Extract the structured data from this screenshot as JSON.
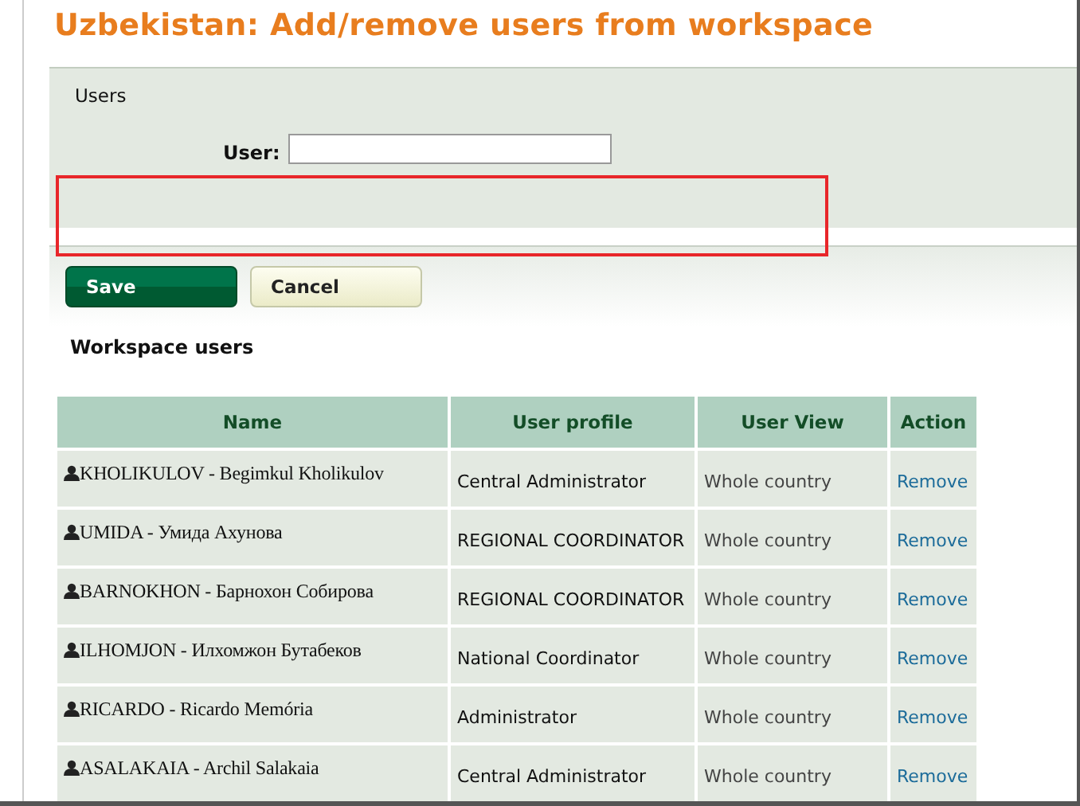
{
  "title": "Uzbekistan: Add/remove users from workspace",
  "users_panel": {
    "heading": "Users",
    "field_label": "User:",
    "highlighted": true
  },
  "buttons": [
    {
      "label": "Save",
      "kind": "primary"
    },
    {
      "label": "Cancel",
      "kind": "secondary"
    }
  ],
  "section_title": "Workspace users",
  "table": {
    "columns": [
      "Name",
      "User profile",
      "User View",
      "Action"
    ],
    "rows": [
      {
        "name": "KHOLIKULOV - Begimkul Kholikulov",
        "profile": "Central Administrator",
        "view": "Whole country",
        "action": "Remove"
      },
      {
        "name": "UMIDA - Умида Ахунова",
        "profile": "REGIONAL COORDINATOR",
        "view": "Whole country",
        "action": "Remove"
      },
      {
        "name": "BARNOKHON - Барнохон Собирова",
        "profile": "REGIONAL COORDINATOR",
        "view": "Whole country",
        "action": "Remove"
      },
      {
        "name": "ILHOMJON - Илхомжон Бутабеков",
        "profile": "National Coordinator",
        "view": "Whole country",
        "action": "Remove"
      },
      {
        "name": "RICARDO - Ricardo Memória",
        "profile": "Administrator",
        "view": "Whole country",
        "action": "Remove"
      },
      {
        "name": "ASALAKAIA - Archil Salakaia",
        "profile": "Central Administrator",
        "view": "Whole country",
        "action": "Remove"
      }
    ]
  }
}
